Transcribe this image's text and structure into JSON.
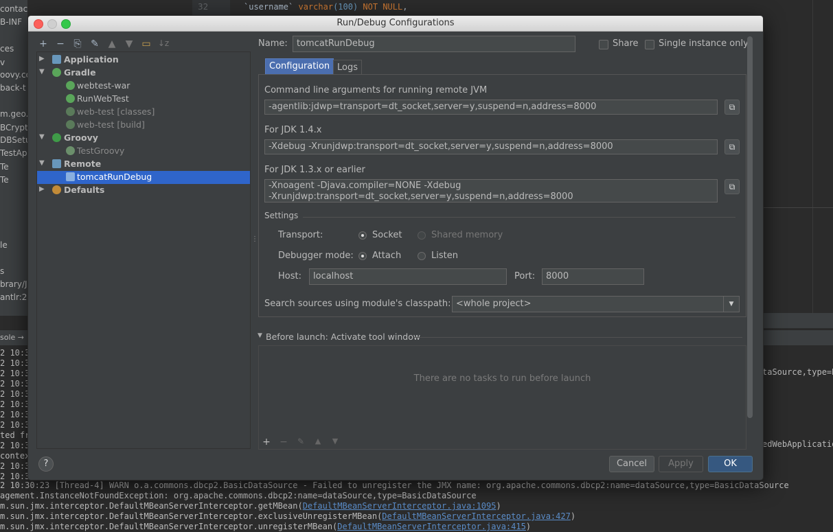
{
  "ide": {
    "left_items": [
      "contact.html",
      "B-INF",
      "ces",
      "v",
      "oovy.co",
      "back-t",
      "m.geo.t",
      "BCrypt",
      "DBSetu",
      "TestAp",
      "Te",
      "Te",
      "le",
      "s",
      "brary/Ja",
      "antlr:2"
    ],
    "gutter_line": "32",
    "code_line": {
      "p1": "`username` ",
      "p2": "varchar",
      "p3": "(100) ",
      "p4": "NOT NULL",
      "p5": ","
    },
    "right_text_1": "taSource,type=Ba",
    "right_text_2": "edWebApplication",
    "console_tab": "sole →",
    "log_prefixes": [
      "2 10:3",
      "2 10:3",
      "2 10:3",
      "2 10:3",
      "2 10:3",
      "2 10:3",
      "2 10:3",
      "2 10:3",
      "ted fr",
      "2 10:3",
      "contex",
      "2 10:3",
      "2 10:3"
    ],
    "log_lines": [
      "2 10:30:23 [Thread-4] WARN  o.a.commons.dbcp2.BasicDataSource - Failed to unregister the JMX name: org.apache.commons.dbcp2:name=dataSource,type=BasicDataSource",
      "agement.InstanceNotFoundException: org.apache.commons.dbcp2:name=dataSource,type=BasicDataSource"
    ],
    "trace_lines": [
      {
        "pre": "m.sun.jmx.interceptor.DefaultMBeanServerInterceptor.getMBean(",
        "link": "DefaultMBeanServerInterceptor.java:1095",
        "post": ")"
      },
      {
        "pre": "m.sun.jmx.interceptor.DefaultMBeanServerInterceptor.exclusiveUnregisterMBean(",
        "link": "DefaultMBeanServerInterceptor.java:427",
        "post": ")"
      },
      {
        "pre": "m.sun.jmx.interceptor.DefaultMBeanServerInterceptor.unregisterMBean(",
        "link": "DefaultMBeanServerInterceptor.java:415",
        "post": ")"
      }
    ]
  },
  "dialog": {
    "title": "Run/Debug Configurations",
    "tree": [
      {
        "label": "Application",
        "level": 0,
        "arrow": "▶",
        "color": "#6897bb"
      },
      {
        "label": "Gradle",
        "level": 0,
        "arrow": "▼",
        "color": "#5aa55a"
      },
      {
        "label": "webtest-war",
        "level": 1,
        "color": "#5aa55a"
      },
      {
        "label": "RunWebTest",
        "level": 1,
        "color": "#5aa55a"
      },
      {
        "label": "web-test [classes]",
        "level": 1,
        "color": "#5a7a5a",
        "dim": true
      },
      {
        "label": "web-test [build]",
        "level": 1,
        "color": "#5a7a5a",
        "dim": true
      },
      {
        "label": "Groovy",
        "level": 0,
        "arrow": "▼",
        "color": "#3f9b48"
      },
      {
        "label": "TestGroovy",
        "level": 1,
        "color": "#6b8f6b",
        "dim": true
      },
      {
        "label": "Remote",
        "level": 0,
        "arrow": "▼",
        "color": "#6897bb"
      },
      {
        "label": "tomcatRunDebug",
        "level": 1,
        "color": "#8ab0e0",
        "selected": true
      },
      {
        "label": "Defaults",
        "level": 0,
        "arrow": "▶",
        "color": "#c28b38"
      }
    ],
    "name_label": "Name:",
    "name_value": "tomcatRunDebug",
    "share_label": "Share",
    "single_instance_label": "Single instance only",
    "tabs": [
      "Configuration",
      "Logs"
    ],
    "cmd_label": "Command line arguments for running remote JVM",
    "cmd_value": "-agentlib:jdwp=transport=dt_socket,server=y,suspend=n,address=8000",
    "jdk14_label": "For JDK 1.4.x",
    "jdk14_value": "-Xdebug -Xrunjdwp:transport=dt_socket,server=y,suspend=n,address=8000",
    "jdk13_label": "For JDK 1.3.x or earlier",
    "jdk13_value_1": "-Xnoagent -Djava.compiler=NONE -Xdebug",
    "jdk13_value_2": "-Xrunjdwp:transport=dt_socket,server=y,suspend=n,address=8000",
    "settings_label": "Settings",
    "transport_label": "Transport:",
    "transport_socket": "Socket",
    "transport_shared": "Shared memory",
    "debugger_label": "Debugger mode:",
    "debugger_attach": "Attach",
    "debugger_listen": "Listen",
    "host_label": "Host:",
    "host_value": "localhost",
    "port_label": "Port:",
    "port_value": "8000",
    "classpath_label": "Search sources using module's classpath:",
    "classpath_value": "<whole project>",
    "before_launch_label": "Before launch: Activate tool window",
    "no_tasks": "There are no tasks to run before launch",
    "cancel": "Cancel",
    "apply": "Apply",
    "ok": "OK",
    "help": "?"
  }
}
